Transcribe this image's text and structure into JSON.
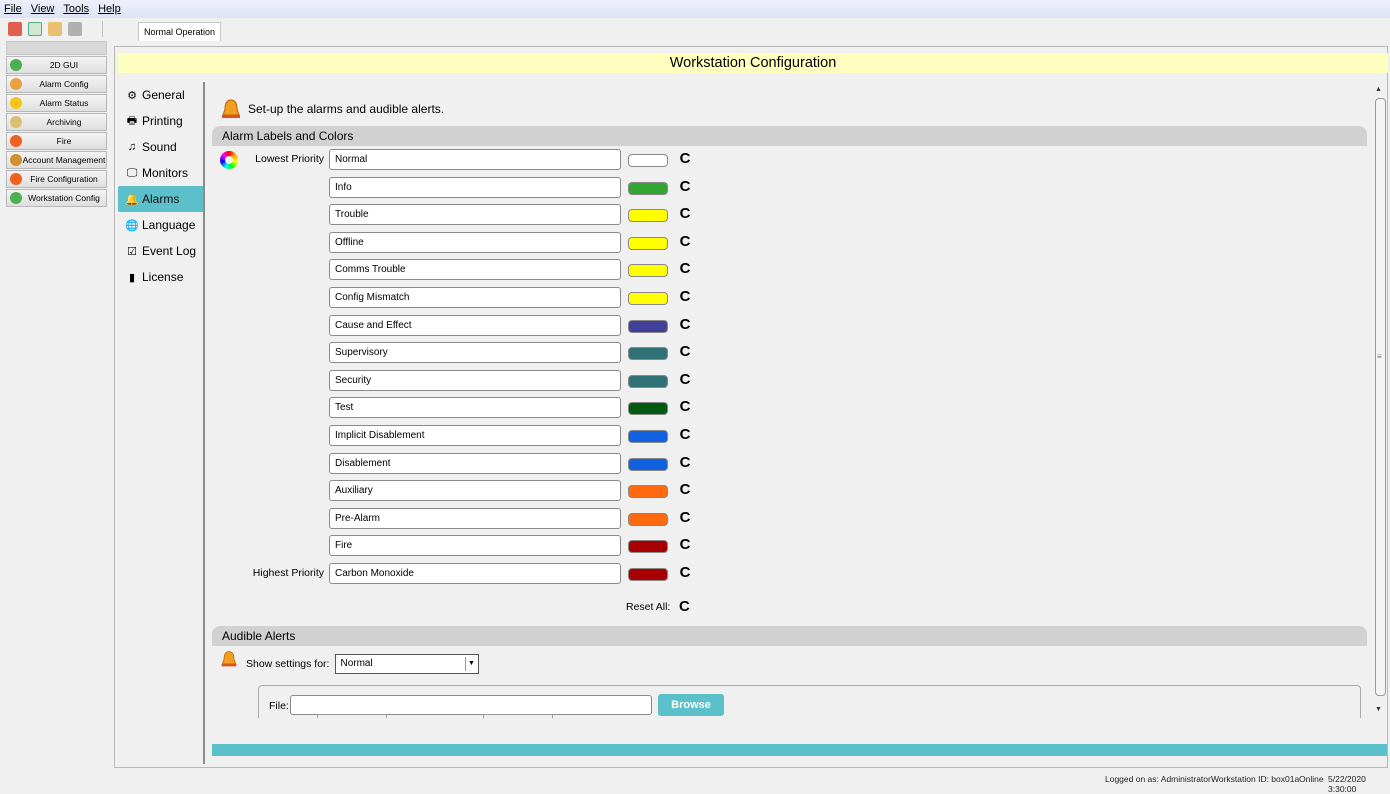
{
  "menu": [
    "File",
    "View",
    "Tools",
    "Help"
  ],
  "toolbar": {
    "icons": [
      "user-icon",
      "window-icon",
      "home-icon",
      "print-icon"
    ]
  },
  "tabs": {
    "active": "Normal Operation"
  },
  "sidebar": {
    "items": [
      {
        "label": "2D GUI",
        "icon": "globe-icon",
        "color": "#4caf50"
      },
      {
        "label": "Alarm Config",
        "icon": "wrench-icon",
        "color": "#e8a040"
      },
      {
        "label": "Alarm Status",
        "icon": "star-icon",
        "color": "#f5c518"
      },
      {
        "label": "Archiving",
        "icon": "archive-icon",
        "color": "#d8c070"
      },
      {
        "label": "Fire",
        "icon": "fire-icon",
        "color": "#f06020"
      },
      {
        "label": "Account Management",
        "icon": "users-icon",
        "color": "#d09030"
      },
      {
        "label": "Fire Configuration",
        "icon": "fire-icon",
        "color": "#f06020"
      },
      {
        "label": "Workstation Config",
        "icon": "globe-icon",
        "color": "#4caf50"
      }
    ]
  },
  "page": {
    "title": "Workstation Configuration"
  },
  "nav": {
    "items": [
      {
        "label": "General",
        "icon": "gear-icon",
        "glyph": "⚙"
      },
      {
        "label": "Printing",
        "icon": "printer-icon",
        "glyph": "🖶"
      },
      {
        "label": "Sound",
        "icon": "speaker-icon",
        "glyph": "♫"
      },
      {
        "label": "Monitors",
        "icon": "monitor-icon",
        "glyph": "🖵"
      },
      {
        "label": "Alarms",
        "icon": "bell-icon",
        "glyph": "🔔"
      },
      {
        "label": "Language",
        "icon": "globe-icon",
        "glyph": "🌐"
      },
      {
        "label": "Event Log",
        "icon": "log-icon",
        "glyph": "☑"
      },
      {
        "label": "License",
        "icon": "license-icon",
        "glyph": "▮"
      }
    ],
    "active": "Alarms"
  },
  "alarms": {
    "intro": "Set-up the alarms and audible alerts.",
    "section_labels": "Alarm Labels and Colors",
    "lowest_label": "Lowest Priority",
    "highest_label": "Highest Priority",
    "rows": [
      {
        "label": "Normal",
        "color": "#ffffff"
      },
      {
        "label": "Info",
        "color": "#33a532"
      },
      {
        "label": "Trouble",
        "color": "#ffff00"
      },
      {
        "label": "Offline",
        "color": "#ffff00"
      },
      {
        "label": "Comms Trouble",
        "color": "#ffff00"
      },
      {
        "label": "Config Mismatch",
        "color": "#ffff00"
      },
      {
        "label": "Cause and Effect",
        "color": "#404099"
      },
      {
        "label": "Supervisory",
        "color": "#2e7275"
      },
      {
        "label": "Security",
        "color": "#2e7275"
      },
      {
        "label": "Test",
        "color": "#005a10"
      },
      {
        "label": "Implicit Disablement",
        "color": "#1060e0"
      },
      {
        "label": "Disablement",
        "color": "#1060e0"
      },
      {
        "label": "Auxiliary",
        "color": "#ff6a10"
      },
      {
        "label": "Pre-Alarm",
        "color": "#ff6a10"
      },
      {
        "label": "Fire",
        "color": "#a80000"
      },
      {
        "label": "Carbon Monoxide",
        "color": "#a80000"
      }
    ],
    "reset_all_label": "Reset All:",
    "reset_glyph": "C"
  },
  "audible": {
    "section": "Audible Alerts",
    "show_label": "Show settings for:",
    "select_value": "Normal",
    "file_label": "File:",
    "file_value": "",
    "browse_label": "Browse"
  },
  "status": {
    "logged": "Logged on as: Administrator",
    "workstation": "Workstation ID: box01a",
    "state": "Online",
    "datetime": "5/22/2020 3:30:00"
  },
  "colors": {
    "accent": "#5bc0ca",
    "title_bg": "#ffffc0"
  }
}
